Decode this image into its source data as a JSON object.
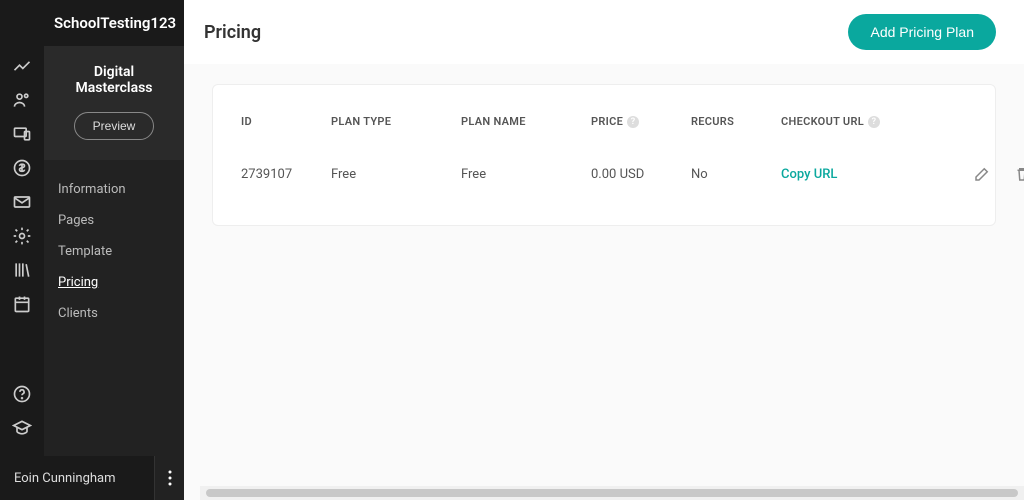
{
  "brand": "SchoolTesting123",
  "course_title": "Digital Masterclass",
  "preview_label": "Preview",
  "nav": {
    "items": [
      {
        "label": "Information",
        "active": false
      },
      {
        "label": "Pages",
        "active": false
      },
      {
        "label": "Template",
        "active": false
      },
      {
        "label": "Pricing",
        "active": true
      },
      {
        "label": "Clients",
        "active": false
      }
    ]
  },
  "footer_user": "Eoin Cunningham",
  "page_title": "Pricing",
  "add_button_label": "Add Pricing Plan",
  "table": {
    "headers": {
      "id": "ID",
      "plan_type": "PLAN TYPE",
      "plan_name": "PLAN NAME",
      "price": "PRICE",
      "recurs": "RECURS",
      "checkout_url": "CHECKOUT URL"
    },
    "rows": [
      {
        "id": "2739107",
        "plan_type": "Free",
        "plan_name": "Free",
        "price": "0.00 USD",
        "recurs": "No",
        "checkout_action": "Copy URL"
      }
    ]
  }
}
